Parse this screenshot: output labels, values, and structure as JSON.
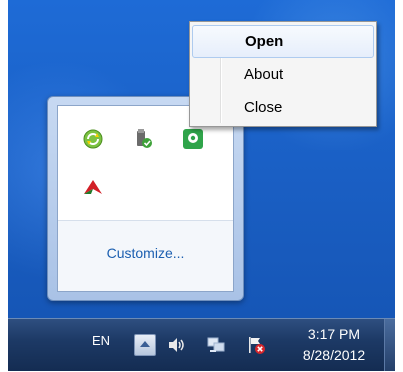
{
  "context_menu": {
    "items": [
      {
        "label": "Open",
        "default": true
      },
      {
        "label": "About",
        "default": false
      },
      {
        "label": "Close",
        "default": false
      }
    ]
  },
  "tray_overflow": {
    "icons": [
      "green-refresh-icon",
      "usb-drive-icon",
      "green-location-icon",
      "red-arrow-app-icon"
    ],
    "customize_label": "Customize..."
  },
  "taskbar": {
    "language": "EN",
    "icons": [
      "show-hidden-icons-arrow",
      "speaker-icon",
      "network-icon",
      "action-center-flag-icon"
    ],
    "time": "3:17 PM",
    "date": "8/28/2012"
  },
  "colors": {
    "desktop_blue": "#1a5fc4",
    "taskbar": "#1d3a66",
    "link_blue": "#1c5fb0"
  }
}
